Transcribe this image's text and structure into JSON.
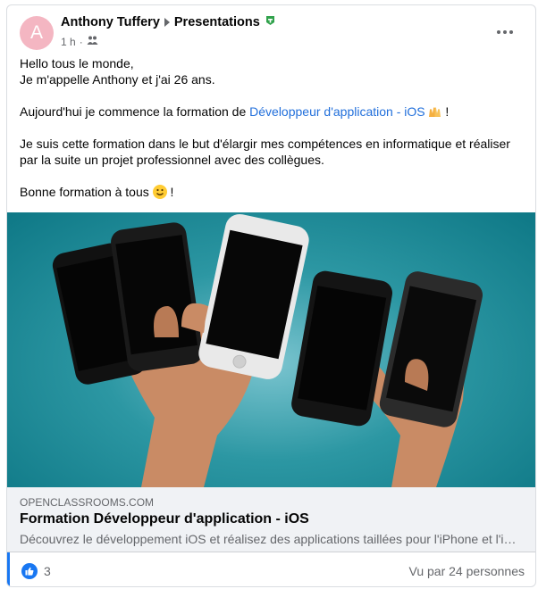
{
  "post": {
    "avatar_letter": "A",
    "author": "Anthony Tuffery",
    "group": "Presentations",
    "time": "1 h",
    "body": {
      "line1": "Hello tous le monde,",
      "line2": "Je m'appelle Anthony et j'ai 26 ans.",
      "line3_before": "Aujourd'hui je commence la formation de ",
      "line3_link": "Développeur d'application - iOS",
      "line3_after": "!",
      "line4": "Je suis cette formation dans le but d'élargir mes compétences en informatique et réaliser par la suite un projet professionnel avec des collègues.",
      "line5": "Bonne formation à tous",
      "line5_after": "!"
    }
  },
  "link_preview": {
    "domain": "OPENCLASSROOMS.COM",
    "title": "Formation Développeur d'application - iOS",
    "description": "Découvrez le développement iOS et réalisez des applications taillées pour l'iPhone et l'iP..."
  },
  "footer": {
    "like_count": "3",
    "seen_by": "Vu par 24 personnes"
  },
  "colors": {
    "link": "#216fdb",
    "accent": "#1877f2",
    "avatar_bg": "#f4b6c2",
    "image_bg": "#2c97a3"
  },
  "icons": [
    "avatar",
    "arrow-right-icon",
    "admin-badge-icon",
    "privacy-group-icon",
    "more-options-icon",
    "raising-hands-emoji-icon",
    "smiling-emoji-icon",
    "like-icon"
  ]
}
